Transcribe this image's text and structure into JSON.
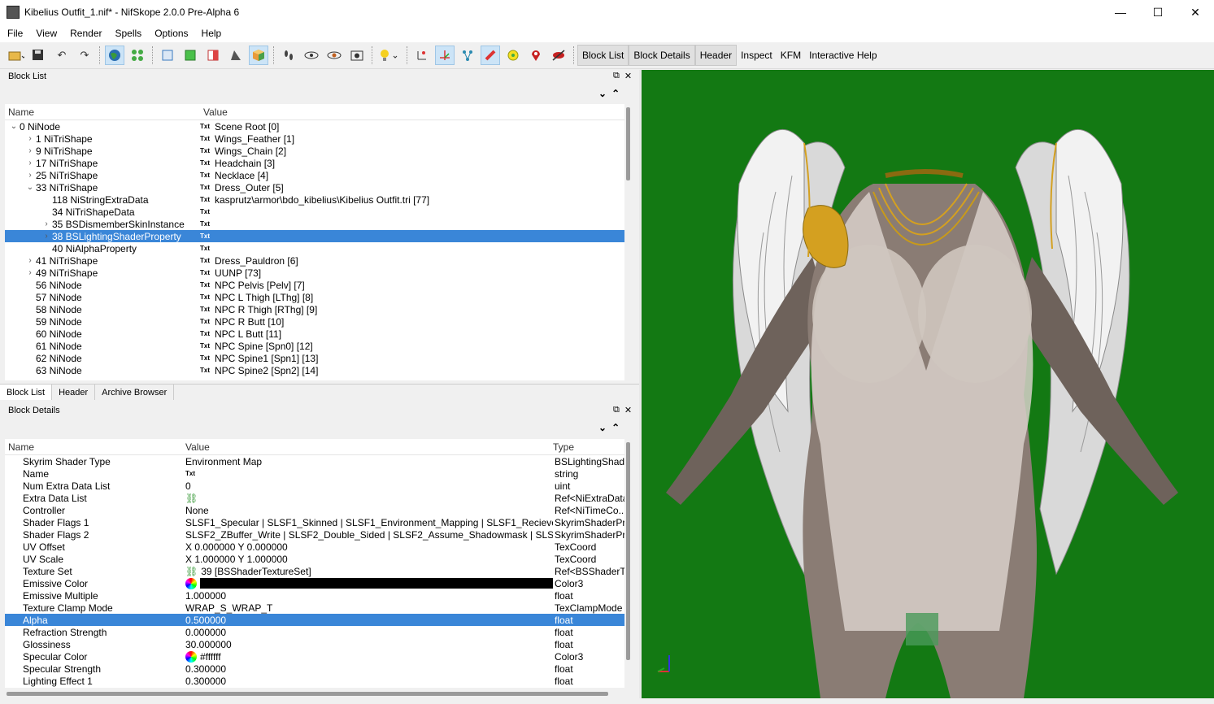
{
  "window": {
    "title": "Kibelius Outfit_1.nif* - NifSkope 2.0.0 Pre-Alpha 6",
    "minimize": "—",
    "maximize": "☐",
    "close": "✕"
  },
  "menu": [
    "File",
    "View",
    "Render",
    "Spells",
    "Options",
    "Help"
  ],
  "toolbar": {
    "text_buttons": [
      "Block List",
      "Block Details",
      "Header",
      "Inspect",
      "KFM",
      "Interactive Help"
    ]
  },
  "block_list": {
    "title": "Block List",
    "col_name": "Name",
    "col_value": "Value",
    "rows": [
      {
        "name": "0 NiNode",
        "value": "Scene Root [0]",
        "arrow": "⌄",
        "indent": 0
      },
      {
        "name": "1 NiTriShape",
        "value": "Wings_Feather [1]",
        "arrow": "›",
        "indent": 1
      },
      {
        "name": "9 NiTriShape",
        "value": "Wings_Chain [2]",
        "arrow": "›",
        "indent": 1
      },
      {
        "name": "17 NiTriShape",
        "value": "Headchain [3]",
        "arrow": "›",
        "indent": 1
      },
      {
        "name": "25 NiTriShape",
        "value": "Necklace [4]",
        "arrow": "›",
        "indent": 1
      },
      {
        "name": "33 NiTriShape",
        "value": "Dress_Outer [5]",
        "arrow": "⌄",
        "indent": 1
      },
      {
        "name": "118 NiStringExtraData",
        "value": "kasprutz\\armor\\bdo_kibelius\\Kibelius Outfit.tri [77]",
        "arrow": "",
        "indent": 2
      },
      {
        "name": "34 NiTriShapeData",
        "value": "",
        "arrow": "",
        "indent": 2
      },
      {
        "name": "35 BSDismemberSkinInstance",
        "value": "",
        "arrow": "›",
        "indent": 2
      },
      {
        "name": "38 BSLightingShaderProperty",
        "value": "",
        "arrow": "›",
        "indent": 2,
        "selected": true
      },
      {
        "name": "40 NiAlphaProperty",
        "value": "",
        "arrow": "",
        "indent": 2
      },
      {
        "name": "41 NiTriShape",
        "value": "Dress_Pauldron [6]",
        "arrow": "›",
        "indent": 1
      },
      {
        "name": "49 NiTriShape",
        "value": "UUNP [73]",
        "arrow": "›",
        "indent": 1
      },
      {
        "name": "56 NiNode",
        "value": "NPC Pelvis [Pelv] [7]",
        "arrow": "",
        "indent": 1
      },
      {
        "name": "57 NiNode",
        "value": "NPC L Thigh [LThg] [8]",
        "arrow": "",
        "indent": 1
      },
      {
        "name": "58 NiNode",
        "value": "NPC R Thigh [RThg] [9]",
        "arrow": "",
        "indent": 1
      },
      {
        "name": "59 NiNode",
        "value": "NPC R Butt [10]",
        "arrow": "",
        "indent": 1
      },
      {
        "name": "60 NiNode",
        "value": "NPC L Butt [11]",
        "arrow": "",
        "indent": 1
      },
      {
        "name": "61 NiNode",
        "value": "NPC Spine [Spn0] [12]",
        "arrow": "",
        "indent": 1
      },
      {
        "name": "62 NiNode",
        "value": "NPC Spine1 [Spn1] [13]",
        "arrow": "",
        "indent": 1
      },
      {
        "name": "63 NiNode",
        "value": "NPC Spine2 [Spn2] [14]",
        "arrow": "",
        "indent": 1
      }
    ]
  },
  "tabs": [
    "Block List",
    "Header",
    "Archive Browser"
  ],
  "block_details": {
    "title": "Block Details",
    "col_name": "Name",
    "col_value": "Value",
    "col_type": "Type",
    "rows": [
      {
        "name": "Skyrim Shader Type",
        "value": "Environment Map",
        "type": "BSLightingShad..."
      },
      {
        "name": "Name",
        "value": "Txt",
        "type": "string",
        "kind": "txt"
      },
      {
        "name": "Num Extra Data List",
        "value": "0",
        "type": "uint"
      },
      {
        "name": "Extra Data List",
        "value": "",
        "type": "Ref<NiExtraData",
        "kind": "link"
      },
      {
        "name": "Controller",
        "value": "None",
        "type": "Ref<NiTimeCo..."
      },
      {
        "name": "Shader Flags 1",
        "value": "SLSF1_Specular | SLSF1_Skinned | SLSF1_Environment_Mapping | SLSF1_Recieve_Sh...",
        "type": "SkyrimShaderPr..."
      },
      {
        "name": "Shader Flags 2",
        "value": "SLSF2_ZBuffer_Write | SLSF2_Double_Sided | SLSF2_Assume_Shadowmask | SLSF2_E...",
        "type": "SkyrimShaderPr..."
      },
      {
        "name": "UV Offset",
        "value": "X 0.000000 Y 0.000000",
        "type": "TexCoord"
      },
      {
        "name": "UV Scale",
        "value": "X 1.000000 Y 1.000000",
        "type": "TexCoord"
      },
      {
        "name": "Texture Set",
        "value": "39 [BSShaderTextureSet]",
        "type": "Ref<BSShaderT...",
        "kind": "link"
      },
      {
        "name": "Emissive Color",
        "value": "",
        "type": "Color3",
        "kind": "black"
      },
      {
        "name": "Emissive Multiple",
        "value": "1.000000",
        "type": "float"
      },
      {
        "name": "Texture Clamp Mode",
        "value": "WRAP_S_WRAP_T",
        "type": "TexClampMode"
      },
      {
        "name": "Alpha",
        "value": "0.500000",
        "type": "float",
        "selected": true
      },
      {
        "name": "Refraction Strength",
        "value": "0.000000",
        "type": "float"
      },
      {
        "name": "Glossiness",
        "value": "30.000000",
        "type": "float"
      },
      {
        "name": "Specular Color",
        "value": "#ffffff",
        "type": "Color3",
        "kind": "color"
      },
      {
        "name": "Specular Strength",
        "value": "0.300000",
        "type": "float"
      },
      {
        "name": "Lighting Effect 1",
        "value": "0.300000",
        "type": "float"
      }
    ]
  },
  "viewport": {
    "background": "#137913",
    "accent_gold": "#d4a020",
    "skin": "#8a7a70",
    "dress": "#d8d0ca",
    "feather": "#e8e8e8"
  }
}
